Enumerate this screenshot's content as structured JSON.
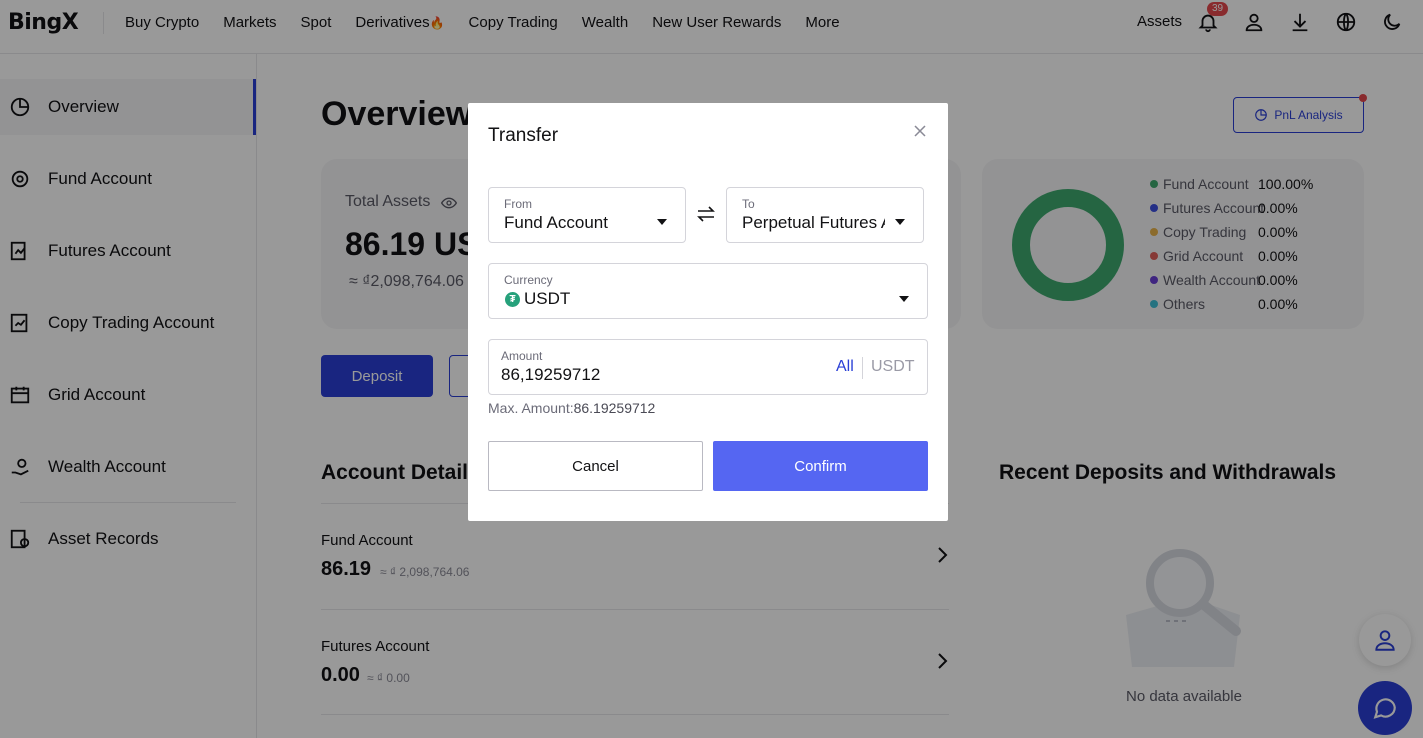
{
  "header": {
    "logo": "BingX",
    "nav": [
      "Buy Crypto",
      "Markets",
      "Spot",
      "Derivatives",
      "Copy Trading",
      "Wealth",
      "New User Rewards",
      "More"
    ],
    "derivatives_badge_icon": "fire-icon",
    "assets_label": "Assets",
    "notification_count": "39",
    "icons": [
      "bell-icon",
      "user-icon",
      "download-icon",
      "globe-icon",
      "moon-icon"
    ]
  },
  "sidebar": {
    "items": [
      {
        "label": "Overview",
        "icon": "pie-chart-icon",
        "active": true
      },
      {
        "label": "Fund Account",
        "icon": "fund-icon",
        "active": false
      },
      {
        "label": "Futures Account",
        "icon": "futures-icon",
        "active": false
      },
      {
        "label": "Copy Trading Account",
        "icon": "copy-trading-icon",
        "active": false
      },
      {
        "label": "Grid Account",
        "icon": "grid-icon",
        "active": false
      },
      {
        "label": "Wealth Account",
        "icon": "wealth-icon",
        "active": false
      },
      {
        "label": "Asset Records",
        "icon": "records-icon",
        "active": false
      }
    ]
  },
  "main": {
    "title": "Overview",
    "pnl_button": "PnL Analysis",
    "total_assets_label": "Total Assets",
    "total_assets_value": "86.19 US",
    "total_assets_fiat": "≈ ₫2,098,764.06",
    "distribution": [
      {
        "name": "Fund Account",
        "pct": "100.00%",
        "color": "#3fa86f"
      },
      {
        "name": "Futures Account",
        "pct": "0.00%",
        "color": "#3d4fe0"
      },
      {
        "name": "Copy Trading",
        "pct": "0.00%",
        "color": "#e8b24a"
      },
      {
        "name": "Grid Account",
        "pct": "0.00%",
        "color": "#e0605a"
      },
      {
        "name": "Wealth Account",
        "pct": "0.00%",
        "color": "#6a3fd6"
      },
      {
        "name": "Others",
        "pct": "0.00%",
        "color": "#3fbfd6"
      }
    ],
    "deposit_button": "Deposit",
    "account_details_title": "Account Details",
    "accounts": [
      {
        "name": "Fund Account",
        "value": "86.19",
        "fiat": "≈ ₫ 2,098,764.06"
      },
      {
        "name": "Futures Account",
        "value": "0.00",
        "fiat": "≈ ₫ 0.00"
      }
    ],
    "recent_title": "Recent Deposits and Withdrawals",
    "no_data": "No data available"
  },
  "modal": {
    "title": "Transfer",
    "from_label": "From",
    "from_value": "Fund Account",
    "to_label": "To",
    "to_value": "Perpetual Futures A",
    "currency_label": "Currency",
    "currency_value": "USDT",
    "currency_logo": "₮",
    "amount_label": "Amount",
    "amount_value": "86,19259712",
    "all_label": "All",
    "unit": "USDT",
    "max_label": "Max. Amount:",
    "max_value": "86.19259712",
    "cancel": "Cancel",
    "confirm": "Confirm"
  },
  "colors": {
    "accent": "#2a3fd6",
    "confirm": "#5566f2",
    "donut": "#3fa86f"
  }
}
